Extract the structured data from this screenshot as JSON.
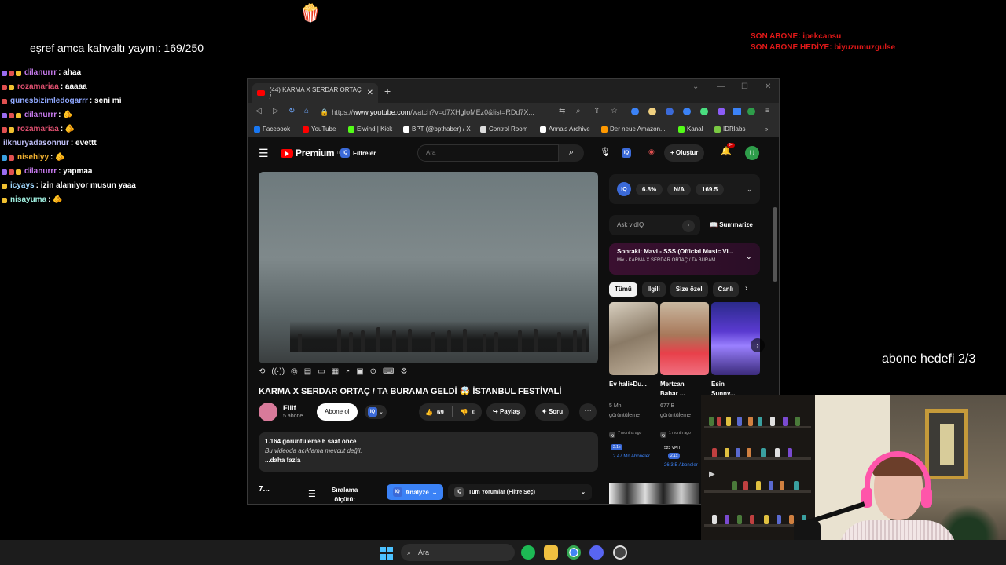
{
  "overlay": {
    "goal_text": "eşref amca kahvaltı yayını: 169/250",
    "popcorn_icon": "popcorn-icon",
    "son_abone": "SON ABONE: ipekcansu",
    "son_abone_hediye": "SON ABONE HEDİYE: biyuzumuzgulse",
    "abone_hedefi": "abone hedefi 2/3",
    "accent_red": "#e01818"
  },
  "chat": [
    {
      "user": "dilanurrr",
      "msg": ": ahaa",
      "color": "#c97cf0",
      "badges": [
        "#9a6cf0",
        "#e05050",
        "#f0c030"
      ]
    },
    {
      "user": "rozamariaa",
      "msg": ": aaaaa",
      "color": "#e05070",
      "badges": [
        "#e05050",
        "#f0c030"
      ]
    },
    {
      "user": "gunesbizimledogarrr",
      "msg": ": seni mi",
      "color": "#8fa8ff",
      "badges": [
        "#e05050"
      ]
    },
    {
      "user": "dilanurrr",
      "msg": ": 🫵",
      "color": "#c97cf0",
      "badges": [
        "#9a6cf0",
        "#e05050",
        "#f0c030"
      ]
    },
    {
      "user": "rozamariaa",
      "msg": ": 🫵",
      "color": "#e05070",
      "badges": [
        "#e05050",
        "#f0c030"
      ]
    },
    {
      "user": "ilknuryadasonnur",
      "msg": ": evettt",
      "color": "#bdbdf5",
      "badges": []
    },
    {
      "user": "nisehlyy",
      "msg": ": 🫵",
      "color": "#f0b030",
      "badges": [
        "#3aa0e0",
        "#e05050"
      ]
    },
    {
      "user": "dilanurrr",
      "msg": ": yapmaa",
      "color": "#c97cf0",
      "badges": [
        "#9a6cf0",
        "#e05050",
        "#f0c030"
      ]
    },
    {
      "user": "icyays",
      "msg": ": izin alamiyor musun yaaa",
      "color": "#a0d8ff",
      "badges": [
        "#f0c030"
      ]
    },
    {
      "user": "nisayuma",
      "msg": ": 🫵",
      "color": "#a0f0e0",
      "badges": [
        "#f0c030"
      ]
    }
  ],
  "browser": {
    "tab_title": "(44) KARMA X SERDAR ORTAÇ /",
    "url_prefix": "https://",
    "url_host": "www.youtube.com",
    "url_rest": "/watch?v=d7XHgIoMEz0&list=RDd7X...",
    "bookmarks": [
      {
        "label": "Facebook",
        "color": "#1877f2"
      },
      {
        "label": "YouTube",
        "color": "#ff0000"
      },
      {
        "label": "Elwind | Kick",
        "color": "#53fc18"
      },
      {
        "label": "BPT (@bpthaber) / X",
        "color": "#ffffff"
      },
      {
        "label": "Control Room",
        "color": "#dddddd"
      },
      {
        "label": "Anna's Archive",
        "color": "#ffffff"
      },
      {
        "label": "Der neue Amazon...",
        "color": "#ff9900"
      },
      {
        "label": "Kanal",
        "color": "#53fc18"
      },
      {
        "label": "IDRlabs",
        "color": "#7ac943"
      }
    ]
  },
  "youtube": {
    "logo": "Premium",
    "logo_sup": "TR",
    "filtreler": "Filtreler",
    "search_placeholder": "Ara",
    "olustur": "+ Oluştur",
    "notif_count": "9+",
    "avatar_letter": "U",
    "video_title": "KARMA X SERDAR ORTAÇ / TA BURAMA GELDİ 🤯 İSTANBUL FESTİVALİ",
    "channel_name": "Ellif",
    "channel_subs": "5 abone",
    "subscribe": "Abone ol",
    "likes": "69",
    "dislikes": "0",
    "share": "Paylaş",
    "ask": "Soru",
    "desc_stats": "1.164 görüntüleme  6 saat önce",
    "desc_none": "Bu videoda açıklama mevcut değil.",
    "desc_more": "...daha fazla",
    "comments_count": "7...",
    "sort_label_1": "Sıralama",
    "sort_label_2": "ölçütü:",
    "analyze": "Analyze",
    "filter_select": "Tüm Yorumlar (Filtre Seç)",
    "vidiq": {
      "engagement": "6.8%",
      "na": "N/A",
      "score": "169.5"
    },
    "ask_placeholder": "Ask vidIQ",
    "summarize": "Summarize",
    "next_title": "Sonraki: Mavi - SSS (Official Music Vi...",
    "next_sub": "Mix - KARMA X SERDAR ORTAÇ / TA BURAM...",
    "chips": [
      "Tümü",
      "İlgili",
      "Size özel",
      "Canlı"
    ],
    "recs": [
      {
        "title": "Ev hali+Du...",
        "meta1": "5 Mn",
        "meta2": "görüntüleme",
        "age": "7 months ago",
        "vph": "",
        "views": "2.47 Mn Aboneler"
      },
      {
        "title": "Mertcan Bahar ...",
        "meta1": "677 B",
        "meta2": "görüntüleme",
        "age": "1 month ago",
        "vph": "523 VPH",
        "views": "26.3 B Aboneler"
      },
      {
        "title": "Esin Sunny...",
        "meta1": "",
        "meta2": "",
        "age": "",
        "vph": "",
        "views": ""
      }
    ],
    "badge_multiplier": "2.1x"
  },
  "taskbar": {
    "search_placeholder": "Ara",
    "icons": [
      "spotify-icon",
      "files-icon",
      "chrome-icon",
      "discord-icon",
      "obs-icon"
    ]
  }
}
